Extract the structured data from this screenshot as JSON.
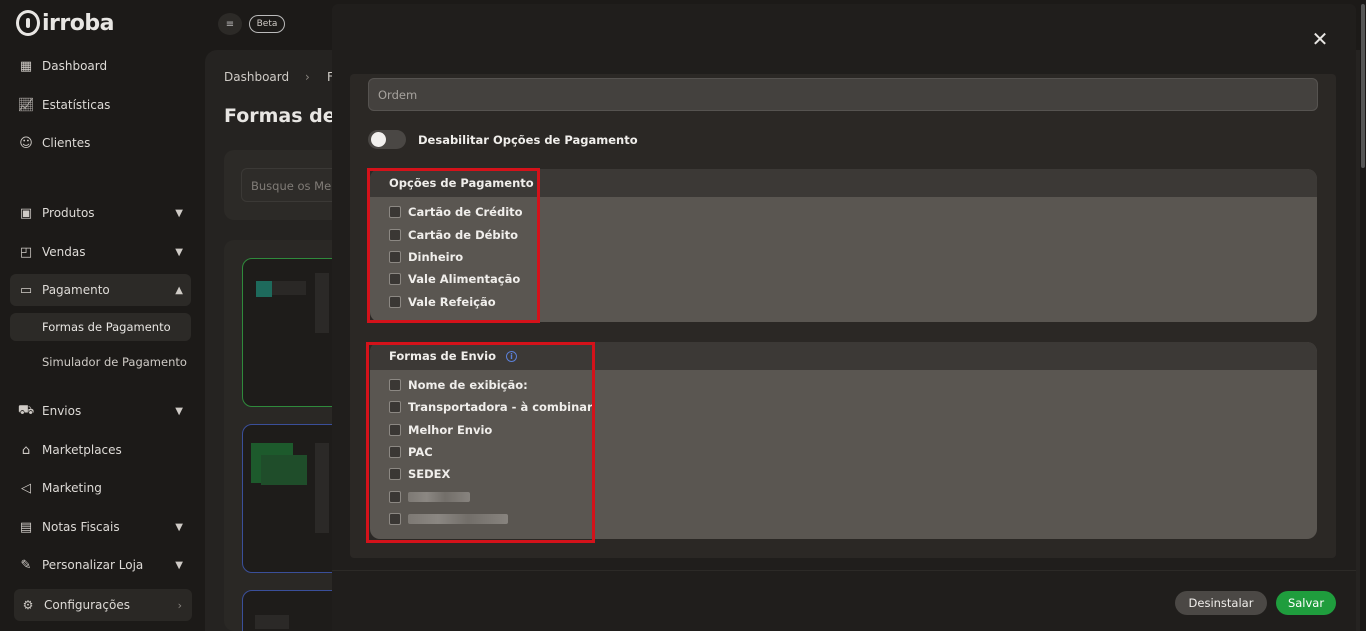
{
  "brand": {
    "logo_text": "irroba"
  },
  "topbar": {
    "beta_label": "Beta"
  },
  "sidebar": {
    "items": [
      {
        "label": "Dashboard",
        "icon": "dashboard-icon"
      },
      {
        "label": "Estatísticas",
        "icon": "chart-icon"
      },
      {
        "label": "Clientes",
        "icon": "users-icon"
      },
      {
        "label": "Produtos",
        "icon": "box-icon"
      },
      {
        "label": "Vendas",
        "icon": "bag-icon"
      },
      {
        "label": "Pagamento",
        "icon": "card-icon"
      },
      {
        "label": "Envios",
        "icon": "truck-icon"
      },
      {
        "label": "Marketplaces",
        "icon": "store-icon"
      },
      {
        "label": "Marketing",
        "icon": "megaphone-icon"
      },
      {
        "label": "Notas Fiscais",
        "icon": "invoice-icon"
      },
      {
        "label": "Personalizar Loja",
        "icon": "brush-icon"
      }
    ],
    "sub_items": [
      {
        "label": "Formas de Pagamento"
      },
      {
        "label": "Simulador de Pagamento"
      }
    ],
    "config_label": "Configurações"
  },
  "main": {
    "breadcrumb_root": "Dashboard",
    "breadcrumb_next": "F",
    "page_title": "Formas de p",
    "search_placeholder": "Busque os Mei"
  },
  "modal": {
    "ordem_placeholder": "Ordem",
    "toggle_label": "Desabilitar Opções de Pagamento",
    "payment_section": {
      "title": "Opções de Pagamento",
      "options": [
        "Cartão de Crédito",
        "Cartão de Débito",
        "Dinheiro",
        "Vale Alimentação",
        "Vale Refeição"
      ]
    },
    "shipping_section": {
      "title": "Formas de Envio",
      "options": [
        "Nome de exibição:",
        "Transportadora - à combinar",
        "Melhor Envio",
        "PAC",
        "SEDEX"
      ]
    },
    "buttons": {
      "uninstall": "Desinstalar",
      "save": "Salvar"
    }
  },
  "colors": {
    "accent_green": "#1f9d3d",
    "highlight_red": "#d4121a",
    "info_blue": "#5b7fd6"
  }
}
